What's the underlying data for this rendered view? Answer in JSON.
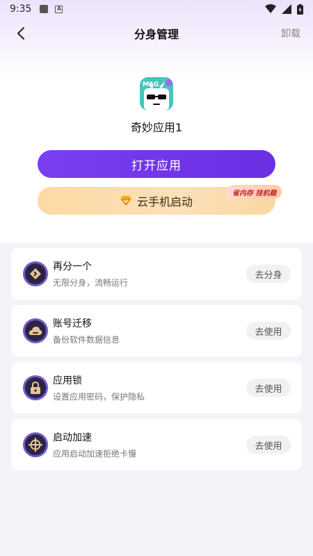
{
  "status_bar": {
    "time": "9:35"
  },
  "header": {
    "title": "分身管理",
    "uninstall_label": "卸载"
  },
  "app": {
    "name": "奇妙应用1",
    "icon_text": "MAG"
  },
  "buttons": {
    "open_label": "打开应用",
    "cloud_label": "云手机启动",
    "cloud_badge": "省内存 挂机稳"
  },
  "features": [
    {
      "title": "再分一个",
      "subtitle": "无限分身，流畅运行",
      "action": "去分身",
      "icon": "diamond-arrow-icon"
    },
    {
      "title": "账号迁移",
      "subtitle": "备份软件数据信息",
      "action": "去使用",
      "icon": "cloud-icon"
    },
    {
      "title": "应用锁",
      "subtitle": "设置应用密码，保护隐私",
      "action": "去使用",
      "icon": "lock-icon"
    },
    {
      "title": "启动加速",
      "subtitle": "应用启动加速拒绝卡慢",
      "action": "去使用",
      "icon": "crosshair-icon"
    }
  ],
  "colors": {
    "primary": "#7035ea",
    "gold": "#fcd9a6",
    "badge_text": "#c0231e"
  }
}
